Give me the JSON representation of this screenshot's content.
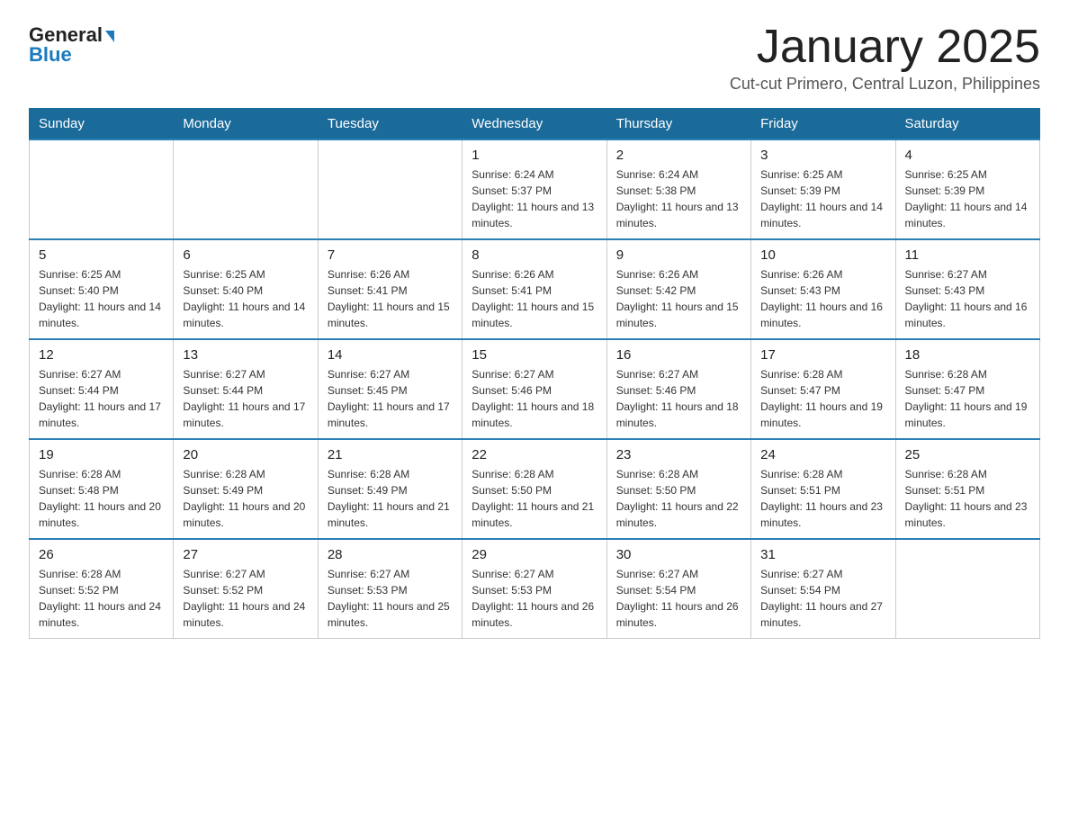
{
  "logo": {
    "general": "General",
    "blue": "Blue"
  },
  "title": "January 2025",
  "subtitle": "Cut-cut Primero, Central Luzon, Philippines",
  "days_of_week": [
    "Sunday",
    "Monday",
    "Tuesday",
    "Wednesday",
    "Thursday",
    "Friday",
    "Saturday"
  ],
  "weeks": [
    [
      {
        "day": "",
        "info": ""
      },
      {
        "day": "",
        "info": ""
      },
      {
        "day": "",
        "info": ""
      },
      {
        "day": "1",
        "info": "Sunrise: 6:24 AM\nSunset: 5:37 PM\nDaylight: 11 hours and 13 minutes."
      },
      {
        "day": "2",
        "info": "Sunrise: 6:24 AM\nSunset: 5:38 PM\nDaylight: 11 hours and 13 minutes."
      },
      {
        "day": "3",
        "info": "Sunrise: 6:25 AM\nSunset: 5:39 PM\nDaylight: 11 hours and 14 minutes."
      },
      {
        "day": "4",
        "info": "Sunrise: 6:25 AM\nSunset: 5:39 PM\nDaylight: 11 hours and 14 minutes."
      }
    ],
    [
      {
        "day": "5",
        "info": "Sunrise: 6:25 AM\nSunset: 5:40 PM\nDaylight: 11 hours and 14 minutes."
      },
      {
        "day": "6",
        "info": "Sunrise: 6:25 AM\nSunset: 5:40 PM\nDaylight: 11 hours and 14 minutes."
      },
      {
        "day": "7",
        "info": "Sunrise: 6:26 AM\nSunset: 5:41 PM\nDaylight: 11 hours and 15 minutes."
      },
      {
        "day": "8",
        "info": "Sunrise: 6:26 AM\nSunset: 5:41 PM\nDaylight: 11 hours and 15 minutes."
      },
      {
        "day": "9",
        "info": "Sunrise: 6:26 AM\nSunset: 5:42 PM\nDaylight: 11 hours and 15 minutes."
      },
      {
        "day": "10",
        "info": "Sunrise: 6:26 AM\nSunset: 5:43 PM\nDaylight: 11 hours and 16 minutes."
      },
      {
        "day": "11",
        "info": "Sunrise: 6:27 AM\nSunset: 5:43 PM\nDaylight: 11 hours and 16 minutes."
      }
    ],
    [
      {
        "day": "12",
        "info": "Sunrise: 6:27 AM\nSunset: 5:44 PM\nDaylight: 11 hours and 17 minutes."
      },
      {
        "day": "13",
        "info": "Sunrise: 6:27 AM\nSunset: 5:44 PM\nDaylight: 11 hours and 17 minutes."
      },
      {
        "day": "14",
        "info": "Sunrise: 6:27 AM\nSunset: 5:45 PM\nDaylight: 11 hours and 17 minutes."
      },
      {
        "day": "15",
        "info": "Sunrise: 6:27 AM\nSunset: 5:46 PM\nDaylight: 11 hours and 18 minutes."
      },
      {
        "day": "16",
        "info": "Sunrise: 6:27 AM\nSunset: 5:46 PM\nDaylight: 11 hours and 18 minutes."
      },
      {
        "day": "17",
        "info": "Sunrise: 6:28 AM\nSunset: 5:47 PM\nDaylight: 11 hours and 19 minutes."
      },
      {
        "day": "18",
        "info": "Sunrise: 6:28 AM\nSunset: 5:47 PM\nDaylight: 11 hours and 19 minutes."
      }
    ],
    [
      {
        "day": "19",
        "info": "Sunrise: 6:28 AM\nSunset: 5:48 PM\nDaylight: 11 hours and 20 minutes."
      },
      {
        "day": "20",
        "info": "Sunrise: 6:28 AM\nSunset: 5:49 PM\nDaylight: 11 hours and 20 minutes."
      },
      {
        "day": "21",
        "info": "Sunrise: 6:28 AM\nSunset: 5:49 PM\nDaylight: 11 hours and 21 minutes."
      },
      {
        "day": "22",
        "info": "Sunrise: 6:28 AM\nSunset: 5:50 PM\nDaylight: 11 hours and 21 minutes."
      },
      {
        "day": "23",
        "info": "Sunrise: 6:28 AM\nSunset: 5:50 PM\nDaylight: 11 hours and 22 minutes."
      },
      {
        "day": "24",
        "info": "Sunrise: 6:28 AM\nSunset: 5:51 PM\nDaylight: 11 hours and 23 minutes."
      },
      {
        "day": "25",
        "info": "Sunrise: 6:28 AM\nSunset: 5:51 PM\nDaylight: 11 hours and 23 minutes."
      }
    ],
    [
      {
        "day": "26",
        "info": "Sunrise: 6:28 AM\nSunset: 5:52 PM\nDaylight: 11 hours and 24 minutes."
      },
      {
        "day": "27",
        "info": "Sunrise: 6:27 AM\nSunset: 5:52 PM\nDaylight: 11 hours and 24 minutes."
      },
      {
        "day": "28",
        "info": "Sunrise: 6:27 AM\nSunset: 5:53 PM\nDaylight: 11 hours and 25 minutes."
      },
      {
        "day": "29",
        "info": "Sunrise: 6:27 AM\nSunset: 5:53 PM\nDaylight: 11 hours and 26 minutes."
      },
      {
        "day": "30",
        "info": "Sunrise: 6:27 AM\nSunset: 5:54 PM\nDaylight: 11 hours and 26 minutes."
      },
      {
        "day": "31",
        "info": "Sunrise: 6:27 AM\nSunset: 5:54 PM\nDaylight: 11 hours and 27 minutes."
      },
      {
        "day": "",
        "info": ""
      }
    ]
  ]
}
